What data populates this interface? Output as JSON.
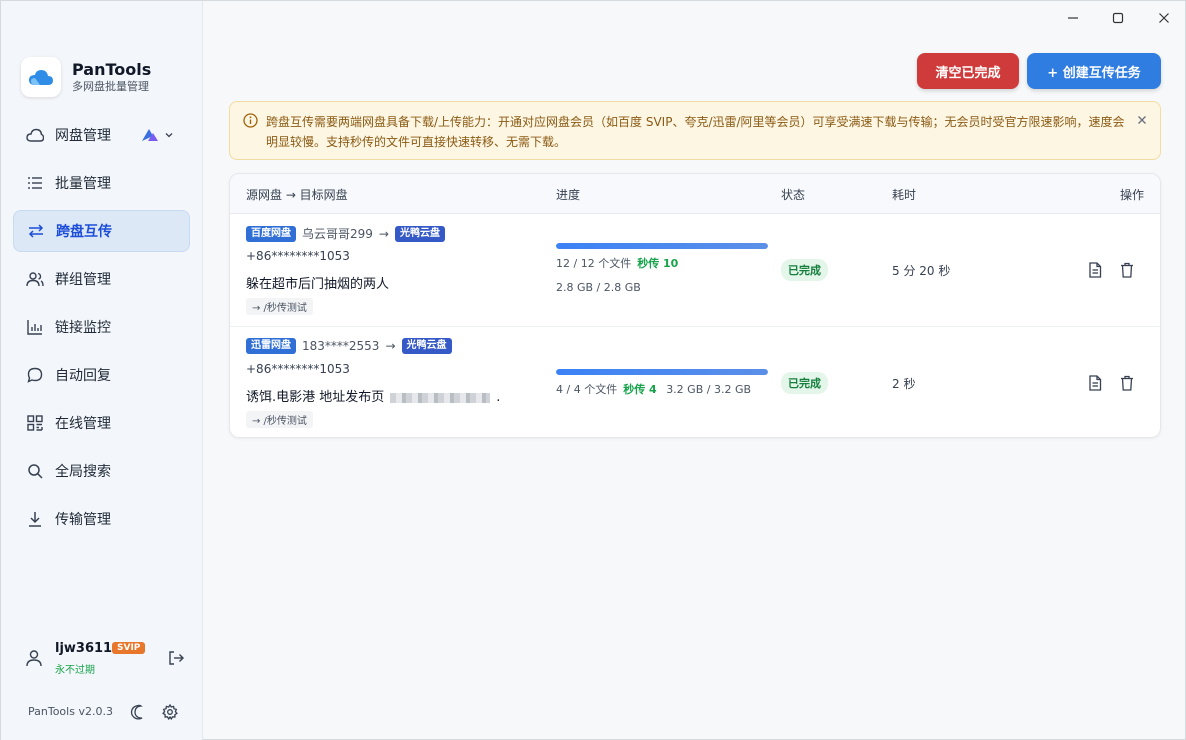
{
  "window": {
    "minimize": "—",
    "maximize": "☐",
    "close": "✕"
  },
  "brand": {
    "name": "PanTools",
    "subtitle": "多网盘批量管理"
  },
  "sidebar": {
    "items": [
      {
        "label": "网盘管理",
        "icon": "cloud-icon"
      },
      {
        "label": "批量管理",
        "icon": "list-icon"
      },
      {
        "label": "跨盘互传",
        "icon": "transfer-icon",
        "active": true
      },
      {
        "label": "群组管理",
        "icon": "users-icon"
      },
      {
        "label": "链接监控",
        "icon": "chart-icon"
      },
      {
        "label": "自动回复",
        "icon": "chat-icon"
      },
      {
        "label": "在线管理",
        "icon": "grid-icon"
      },
      {
        "label": "全局搜索",
        "icon": "search-icon"
      },
      {
        "label": "传输管理",
        "icon": "download-icon"
      }
    ]
  },
  "user": {
    "name": "ljw3611",
    "badge": "SVIP",
    "expiry": "永不过期"
  },
  "footer": {
    "version": "PanTools v2.0.3"
  },
  "toolbar": {
    "clear_label": "清空已完成",
    "create_label": "+ 创建互传任务"
  },
  "notice": {
    "text": "跨盘互传需要两端网盘具备下载/上传能力：开通对应网盘会员（如百度 SVIP、夸克/迅雷/阿里等会员）可享受满速下载与传输；无会员时受官方限速影响，速度会明显较慢。支持秒传的文件可直接快速转移、无需下载。",
    "close": "×"
  },
  "table": {
    "headers": {
      "route": "源网盘 → 目标网盘",
      "progress": "进度",
      "status": "状态",
      "elapsed": "耗时",
      "actions": "操作"
    },
    "rows": [
      {
        "src_tag": "百度网盘",
        "src_account": "乌云哥哥299",
        "arrow": "→",
        "dst_tag": "光鸭云盘",
        "dst_phone": "+86********1053",
        "file_name": "躲在超市后门抽烟的两人",
        "path": "→ /秒传测试",
        "files_text": "12 / 12 个文件",
        "fast_text": "秒传 10",
        "size_text": "2.8 GB / 2.8 GB",
        "progress": 1.0,
        "status": "已完成",
        "elapsed": "5 分 20 秒"
      },
      {
        "src_tag": "迅雷网盘",
        "src_account": "183****2553",
        "arrow": "→",
        "dst_tag": "光鸭云盘",
        "dst_phone": "+86********1053",
        "file_name": "诱饵.电影港 地址发布页",
        "file_suffix": ".",
        "path": "→ /秒传测试",
        "files_text": "4 / 4 个文件",
        "fast_text": "秒传 4",
        "size_text": "3.2 GB / 3.2 GB",
        "progress": 1.0,
        "status": "已完成",
        "elapsed": "2 秒"
      }
    ]
  },
  "colors": {
    "accent": "#2f7de1",
    "danger": "#cf3b3b",
    "success": "#15803d",
    "svip": "#e8762b"
  }
}
